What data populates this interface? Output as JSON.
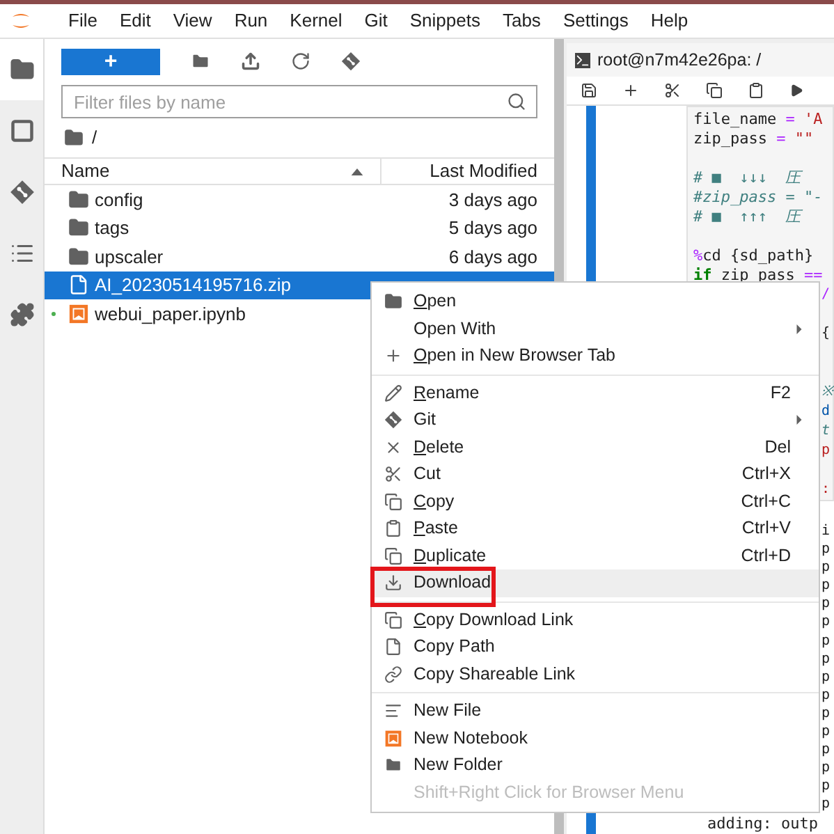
{
  "menu_bar": [
    "File",
    "Edit",
    "View",
    "Run",
    "Kernel",
    "Git",
    "Snippets",
    "Tabs",
    "Settings",
    "Help"
  ],
  "sidebar_tabs": [
    {
      "kind": "folder",
      "selected": true
    },
    {
      "kind": "running",
      "selected": false
    },
    {
      "kind": "git",
      "selected": false
    },
    {
      "kind": "toc",
      "selected": false
    },
    {
      "kind": "extensions",
      "selected": false
    }
  ],
  "file_browser": {
    "new_button": "+",
    "filter": {
      "placeholder": "Filter files by name"
    },
    "breadcrumb": "/",
    "columns": [
      "Name",
      "Last Modified"
    ],
    "rows": [
      {
        "kind": "folder",
        "name": "config",
        "modified": "3 days ago",
        "selected": false,
        "running": false
      },
      {
        "kind": "folder",
        "name": "tags",
        "modified": "5 days ago",
        "selected": false,
        "running": false
      },
      {
        "kind": "folder",
        "name": "upscaler",
        "modified": "6 days ago",
        "selected": false,
        "running": false
      },
      {
        "kind": "file",
        "name": "AI_20230514195716.zip",
        "selected": true,
        "running": false
      },
      {
        "kind": "notebook",
        "name": "webui_paper.ipynb",
        "selected": false,
        "running": true
      }
    ]
  },
  "editor": {
    "tab": {
      "title": "root@n7m42e26pa: /"
    },
    "code": [
      {
        "kind": "line",
        "segments": [
          {
            "text": "file_name ",
            "kind": "plain"
          },
          {
            "text": "=",
            "kind": "op"
          },
          {
            "text": " 'A",
            "kind": "string"
          }
        ]
      },
      {
        "kind": "line",
        "segments": [
          {
            "text": "zip_pass ",
            "kind": "plain"
          },
          {
            "text": "=",
            "kind": "op"
          },
          {
            "text": " \"\"",
            "kind": "string"
          }
        ]
      },
      {
        "kind": "blank"
      },
      {
        "kind": "line",
        "segments": [
          {
            "text": "# ■  ↓↓↓  圧",
            "kind": "comment"
          }
        ]
      },
      {
        "kind": "line",
        "segments": [
          {
            "text": "#zip_pass = \"-",
            "kind": "comment"
          }
        ]
      },
      {
        "kind": "line",
        "segments": [
          {
            "text": "# ■  ↑↑↑  圧",
            "kind": "comment"
          }
        ]
      },
      {
        "kind": "blank"
      },
      {
        "kind": "line",
        "segments": [
          {
            "text": "%",
            "kind": "magic"
          },
          {
            "text": "cd {sd_path}",
            "kind": "plain"
          }
        ]
      },
      {
        "kind": "line",
        "segments": [
          {
            "text": "if",
            "kind": "keyword"
          },
          {
            "text": " zip_pass ",
            "kind": "plain"
          },
          {
            "text": "==",
            "kind": "op"
          }
        ]
      }
    ],
    "code_edges": [
      {
        "kind": "op",
        "text": "/"
      },
      {
        "kind": "blank"
      },
      {
        "kind": "plain",
        "text": "{"
      },
      {
        "kind": "blank"
      },
      {
        "kind": "blank"
      },
      {
        "kind": "comment",
        "text": "※"
      },
      {
        "kind": "name",
        "text": "d"
      },
      {
        "kind": "comment",
        "text": "t"
      },
      {
        "kind": "string",
        "text": "p"
      },
      {
        "kind": "blank"
      },
      {
        "kind": "string",
        "text": ":"
      }
    ],
    "output": [
      {
        "text": "i",
        "kind": "edge"
      },
      {
        "text": "p",
        "kind": "edge"
      },
      {
        "text": "p",
        "kind": "edge"
      },
      {
        "text": "p",
        "kind": "edge"
      },
      {
        "text": "p",
        "kind": "edge"
      },
      {
        "text": "p",
        "kind": "edge"
      },
      {
        "text": "p",
        "kind": "edge"
      },
      {
        "text": "p",
        "kind": "edge"
      },
      {
        "text": "p",
        "kind": "edge"
      },
      {
        "text": "p",
        "kind": "edge"
      },
      {
        "text": "p",
        "kind": "edge"
      },
      {
        "text": "p",
        "kind": "edge"
      },
      {
        "text": "p",
        "kind": "edge"
      },
      {
        "text": "p",
        "kind": "edge"
      },
      {
        "text": "p",
        "kind": "edge"
      },
      {
        "text": "p",
        "kind": "edge"
      },
      {
        "text": "adding: outp",
        "kind": "full"
      }
    ]
  },
  "context_menu": {
    "items": [
      {
        "kind": "item",
        "label": "Open",
        "mnemonic": true,
        "submenu": false,
        "hovered": false,
        "annotated": false
      },
      {
        "kind": "item",
        "label": "Open With",
        "mnemonic": false,
        "submenu": true,
        "hovered": false,
        "annotated": false
      },
      {
        "kind": "item",
        "label": "Open in New Browser Tab",
        "mnemonic": true,
        "submenu": false,
        "hovered": false,
        "annotated": false
      },
      {
        "kind": "separator"
      },
      {
        "kind": "item",
        "label": "Rename",
        "shortcut": "F2",
        "mnemonic": true,
        "submenu": false,
        "hovered": false,
        "annotated": false
      },
      {
        "kind": "item",
        "label": "Git",
        "mnemonic": false,
        "submenu": true,
        "hovered": false,
        "annotated": false
      },
      {
        "kind": "item",
        "label": "Delete",
        "shortcut": "Del",
        "mnemonic": true,
        "submenu": false,
        "hovered": false,
        "annotated": false
      },
      {
        "kind": "item",
        "label": "Cut",
        "shortcut": "Ctrl+X",
        "mnemonic": false,
        "submenu": false,
        "hovered": false,
        "annotated": false
      },
      {
        "kind": "item",
        "label": "Copy",
        "shortcut": "Ctrl+C",
        "mnemonic": true,
        "submenu": false,
        "hovered": false,
        "annotated": false
      },
      {
        "kind": "item",
        "label": "Paste",
        "shortcut": "Ctrl+V",
        "mnemonic": true,
        "submenu": false,
        "hovered": false,
        "annotated": false
      },
      {
        "kind": "item",
        "label": "Duplicate",
        "shortcut": "Ctrl+D",
        "mnemonic": true,
        "submenu": false,
        "hovered": false,
        "annotated": false
      },
      {
        "kind": "item",
        "label": "Download",
        "mnemonic": false,
        "submenu": false,
        "hovered": true,
        "annotated": true
      },
      {
        "kind": "separator"
      },
      {
        "kind": "item",
        "label": "Copy Download Link",
        "mnemonic": true,
        "submenu": false,
        "hovered": false,
        "annotated": false
      },
      {
        "kind": "item",
        "label": "Copy Path",
        "mnemonic": false,
        "submenu": false,
        "hovered": false,
        "annotated": false
      },
      {
        "kind": "item",
        "label": "Copy Shareable Link",
        "mnemonic": false,
        "submenu": false,
        "hovered": false,
        "annotated": false
      },
      {
        "kind": "separator"
      },
      {
        "kind": "item",
        "label": "New File",
        "mnemonic": false,
        "submenu": false,
        "hovered": false,
        "annotated": false
      },
      {
        "kind": "item",
        "label": "New Notebook",
        "mnemonic": false,
        "submenu": false,
        "hovered": false,
        "annotated": false
      },
      {
        "kind": "item",
        "label": "New Folder",
        "mnemonic": false,
        "submenu": false,
        "hovered": false,
        "annotated": false
      },
      {
        "kind": "hint",
        "label": "Shift+Right Click for Browser Menu"
      }
    ]
  }
}
